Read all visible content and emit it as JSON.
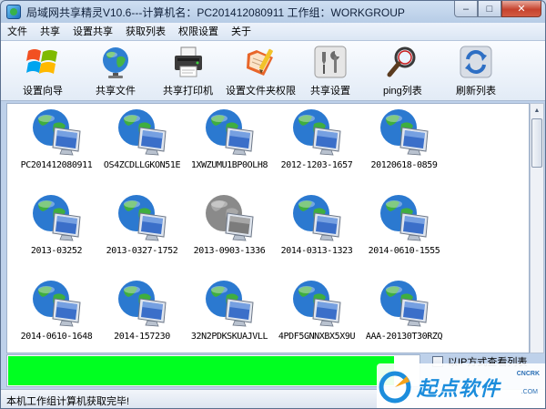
{
  "window": {
    "title": "局域网共享精灵V10.6---计算机名：PC201412080911  工作组：WORKGROUP"
  },
  "menu": [
    "文件",
    "共享",
    "设置共享",
    "获取列表",
    "权限设置",
    "关于"
  ],
  "toolbar": [
    {
      "label": "设置向导",
      "icon": "windows-logo-icon"
    },
    {
      "label": "共享文件",
      "icon": "globe-icon"
    },
    {
      "label": "共享打印机",
      "icon": "printer-icon"
    },
    {
      "label": "设置文件夹权限",
      "icon": "folder-pencil-icon"
    },
    {
      "label": "共享设置",
      "icon": "tools-icon"
    },
    {
      "label": "ping列表",
      "icon": "magnifier-icon"
    },
    {
      "label": "刷新列表",
      "icon": "refresh-icon"
    }
  ],
  "computers": [
    {
      "name": "PC201412080911",
      "status": "online"
    },
    {
      "name": "OS4ZCDLLGKON51E",
      "status": "online"
    },
    {
      "name": "1XWZUMU1BP0OLH8",
      "status": "online"
    },
    {
      "name": "2012-1203-1657",
      "status": "online"
    },
    {
      "name": "20120618-0859",
      "status": "online"
    },
    {
      "name": "2013-03252",
      "status": "online"
    },
    {
      "name": "2013-0327-1752",
      "status": "online"
    },
    {
      "name": "2013-0903-1336",
      "status": "offline"
    },
    {
      "name": "2014-0313-1323",
      "status": "online"
    },
    {
      "name": "2014-0610-1555",
      "status": "online"
    },
    {
      "name": "2014-0610-1648",
      "status": "online"
    },
    {
      "name": "2014-157230",
      "status": "online"
    },
    {
      "name": "32N2PDKSKUAJVLL",
      "status": "online"
    },
    {
      "name": "4PDF5GNNXBX5X9U",
      "status": "online"
    },
    {
      "name": "AAA-20130T30RZQ",
      "status": "online"
    }
  ],
  "progress": {
    "fraction": 0.94,
    "color": "#00ff21"
  },
  "options": {
    "ip_view_label": "以IP方式查看列表"
  },
  "status": {
    "text": "本机工作组计算机获取完毕!"
  },
  "watermark": {
    "text": "起点软件",
    "sub1": "CNCRK",
    "sub2": ".COM"
  },
  "colors": {
    "accent": "#1c8ddc",
    "progress": "#00ff21"
  }
}
